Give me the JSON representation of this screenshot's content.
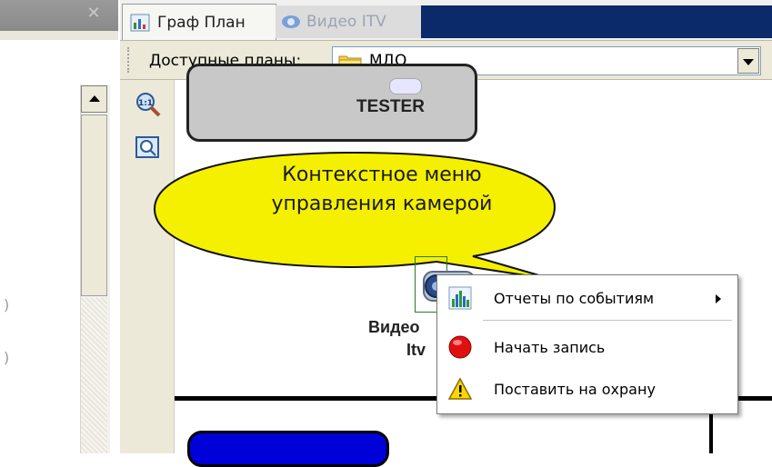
{
  "tabs": [
    {
      "label": "Граф План",
      "active": true
    },
    {
      "label": "Видео ITV",
      "active": false
    }
  ],
  "left_panel": {
    "close_glyph": "✕",
    "fragment_1": ")",
    "fragment_2": ")"
  },
  "plan_bar": {
    "label": "Доступные планы:",
    "selected_value": "МДО",
    "icon": "folder-icon"
  },
  "tools": [
    {
      "icon": "zoom-1to1-icon"
    },
    {
      "icon": "zoom-fit-icon"
    }
  ],
  "map": {
    "tester_label": "TESTER",
    "callout_line1": "Контекстное меню",
    "callout_line2": "управления камерой",
    "camera_label_line1": "Видео",
    "camera_label_line2": "Itv"
  },
  "context_menu": {
    "items": [
      {
        "label": "Отчеты по событиям",
        "icon": "bar-chart-icon",
        "has_submenu": true
      },
      {
        "label": "Начать запись",
        "icon": "record-icon",
        "has_submenu": false
      },
      {
        "label": "Поставить на охрану",
        "icon": "warning-icon",
        "has_submenu": false
      }
    ]
  },
  "colors": {
    "callout_fill": "#f5f000",
    "tab_blue": "#0a2a6a",
    "record_red": "#e01010",
    "object_blue": "#0000d8"
  }
}
